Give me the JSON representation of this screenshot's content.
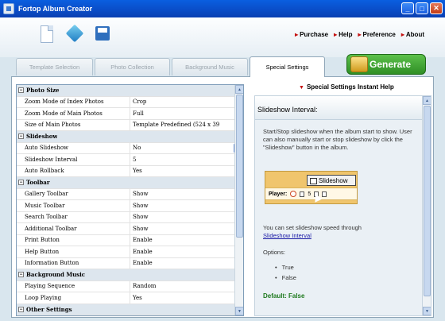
{
  "window": {
    "title": "Fortop Album Creator",
    "minimize": "_",
    "maximize": "□",
    "close": "✕"
  },
  "toolbar": {
    "new_icon": "new-document-icon",
    "open_icon": "open-icon",
    "save_icon": "save-icon"
  },
  "links": [
    {
      "label": "Purchase"
    },
    {
      "label": "Help"
    },
    {
      "label": "Preference"
    },
    {
      "label": "About"
    }
  ],
  "tabs": [
    {
      "label": "Template Selection"
    },
    {
      "label": "Photo Collection"
    },
    {
      "label": "Background Music"
    },
    {
      "label": "Special Settings"
    }
  ],
  "generate_label": "Generate",
  "grid": {
    "categories": {
      "photo_size": "Photo Size",
      "slideshow": "Slideshow",
      "toolbar": "Toolbar",
      "background_music": "Background Music",
      "other": "Other Settings"
    },
    "rows": {
      "r1": {
        "k": "Zoom Mode of Index Photos",
        "v": "Crop"
      },
      "r2": {
        "k": "Zoom Mode of Main Photos",
        "v": "Full"
      },
      "r3": {
        "k": "Size of Main Photos",
        "v": "Template Predefined (524 x 39"
      },
      "r4": {
        "k": "Auto Slideshow",
        "v": "No"
      },
      "r5": {
        "k": "Slideshow Interval",
        "v": "5"
      },
      "r6": {
        "k": "Auto Rollback",
        "v": "Yes"
      },
      "r7": {
        "k": "Gallery Toolbar",
        "v": "Show"
      },
      "r8": {
        "k": "Music Toolbar",
        "v": "Show"
      },
      "r9": {
        "k": "Search Toolbar",
        "v": "Show"
      },
      "r10": {
        "k": "Additional Toolbar",
        "v": "Show"
      },
      "r11": {
        "k": "Print Button",
        "v": "Enable"
      },
      "r12": {
        "k": "Help Button",
        "v": "Enable"
      },
      "r13": {
        "k": "Information Button",
        "v": "Enable"
      },
      "r14": {
        "k": "Playing Sequence",
        "v": "Random"
      },
      "r15": {
        "k": "Loop Playing",
        "v": "Yes"
      }
    }
  },
  "help": {
    "link": "Special Settings Instant Help",
    "header": "Slideshow Interval:",
    "p1": "Start/Stop slideshow when the album start to show. User can also manually start or stop slideshow by click the \"Slideshow\" button in the album.",
    "shot_popup": "Slideshow",
    "shot_player": "Player:",
    "shot_num": "5",
    "p2": "You can set slideshow speed through",
    "p2_link": "Slideshow Interval",
    "options_label": "Options:",
    "options": [
      "True",
      "False"
    ],
    "default": "Default: False"
  }
}
